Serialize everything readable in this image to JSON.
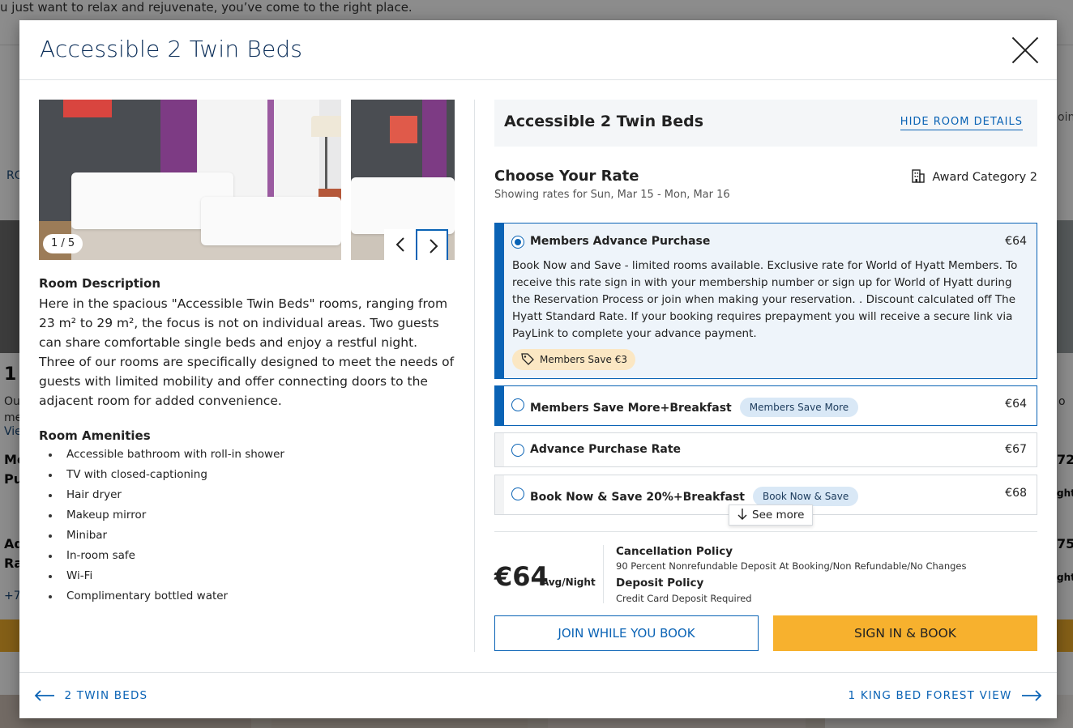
{
  "background": {
    "top_text": "u just want to relax and rejuvenate, you’ve come to the right place.",
    "frag_ro": "RO",
    "frag_1": "1",
    "frag_ou": "Ou",
    "frag_me": "me",
    "frag_vie": "Vie",
    "frag_me2": "Me",
    "frag_pu": "Pu",
    "frag_ad": "Ad",
    "frag_ra": "Ra",
    "frag_plus7": "+7",
    "frag_r_oin": "oin",
    "frag_r_o": "o",
    "frag_r_72": "72",
    "frag_r_ght1": "ght",
    "frag_r_75": "75",
    "frag_r_ght2": "ght"
  },
  "modal": {
    "title": "Accessible 2 Twin Beds",
    "close_icon": "close-icon"
  },
  "gallery": {
    "counter": "1 / 5",
    "prev_icon": "chevron-left-icon",
    "next_icon": "chevron-right-icon"
  },
  "room_description": {
    "title": "Room Description",
    "text": "Here in the spacious \"Accessible Twin Beds\" rooms, ranging from 23 m² to 29 m², the focus is not on individual areas. Two guests can share comfortable single beds and enjoy a restful night. Three of our rooms are specifically designed to meet the needs of guests with limited mobility and offer connecting doors to the adjacent room for added convenience."
  },
  "amenities": {
    "title": "Room Amenities",
    "items": [
      "Accessible bathroom with roll-in shower",
      "TV with closed-captioning",
      "Hair dryer",
      "Makeup mirror",
      "Minibar",
      "In-room safe",
      "Wi-Fi",
      "Complimentary bottled water"
    ]
  },
  "room_box": {
    "title": "Accessible 2 Twin Beds",
    "hide_label": "HIDE ROOM DETAILS"
  },
  "rates": {
    "title": "Choose Your Rate",
    "showing": "Showing rates for Sun, Mar 15 - Mon, Mar 16",
    "award": "Award Category 2",
    "award_icon": "building-icon",
    "items": [
      {
        "name": "Members Advance Purchase",
        "price": "€64",
        "description": "Book Now and Save - limited rooms available. Exclusive rate for World of Hyatt Members. To receive this rate sign in with your membership number or sign up for World of Hyatt during the Reservation Process or join when making your reservation. . Discount calculated off The Hyatt Standard Rate. If your booking requires prepayment you will receive a secure link via PayLink to complete your advance payment.",
        "badge": "Members Save €3",
        "badge_icon": "tag-icon"
      },
      {
        "name": "Members Save More+Breakfast",
        "price": "€64",
        "tag": "Members Save More"
      },
      {
        "name": "Advance Purchase Rate",
        "price": "€67"
      },
      {
        "name": "Book Now & Save 20%+Breakfast",
        "price": "€68",
        "tag": "Book Now & Save"
      }
    ],
    "see_more": "See more",
    "see_more_icon": "arrow-down-icon"
  },
  "summary": {
    "price": "€64",
    "per_night": "Avg/Night",
    "cancellation_title": "Cancellation Policy",
    "cancellation_text": "90 Percent Nonrefundable Deposit At Booking/Non Refundable/No Changes",
    "deposit_title": "Deposit Policy",
    "deposit_text": "Credit Card Deposit Required"
  },
  "buttons": {
    "join": "JOIN WHILE YOU BOOK",
    "sign_in": "SIGN IN & BOOK"
  },
  "footer": {
    "prev": "2 TWIN BEDS",
    "next": "1 KING BED FOREST VIEW",
    "prev_icon": "arrow-left-icon",
    "next_icon": "arrow-right-icon"
  },
  "colors": {
    "accent": "#0a63b5",
    "title": "#0a2d58",
    "cta": "#f7b12e",
    "member_badge": "#fbe7c3",
    "tag_bg": "#d9e8f6"
  }
}
